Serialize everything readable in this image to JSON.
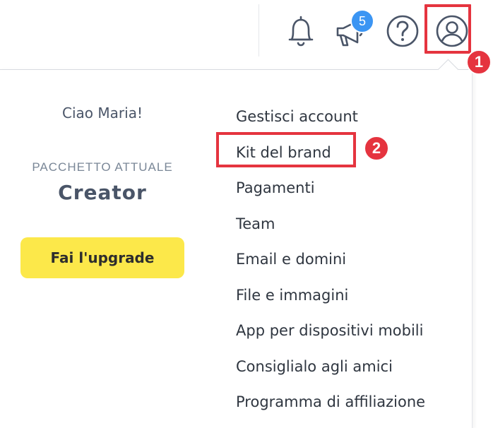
{
  "header": {
    "icons": [
      "bell-icon",
      "megaphone-icon",
      "help-icon",
      "user-icon"
    ],
    "notifications_count": "5"
  },
  "annotations": {
    "step1": "1",
    "step2": "2",
    "color": "#e5343f"
  },
  "account_menu": {
    "greeting": "Ciao Maria!",
    "plan_label": "PACCHETTO ATTUALE",
    "plan_name": "Creator",
    "upgrade_button": "Fai l'upgrade",
    "upgrade_color": "#fce84a",
    "items": [
      {
        "label": "Gestisci account"
      },
      {
        "label": "Kit del brand"
      },
      {
        "label": "Pagamenti"
      },
      {
        "label": "Team"
      },
      {
        "label": "Email e domini"
      },
      {
        "label": "File e immagini"
      },
      {
        "label": "App per dispositivi mobili"
      },
      {
        "label": "Consiglialo agli amici"
      },
      {
        "label": "Programma di affiliazione"
      }
    ]
  }
}
